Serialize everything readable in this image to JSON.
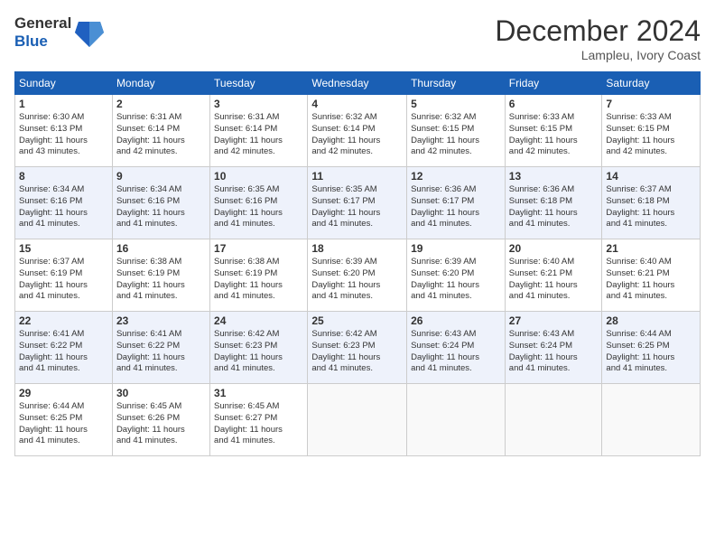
{
  "header": {
    "logo_line1": "General",
    "logo_line2": "Blue",
    "month_title": "December 2024",
    "location": "Lampleu, Ivory Coast"
  },
  "days_of_week": [
    "Sunday",
    "Monday",
    "Tuesday",
    "Wednesday",
    "Thursday",
    "Friday",
    "Saturday"
  ],
  "weeks": [
    [
      {
        "day": "1",
        "sunrise": "6:30 AM",
        "sunset": "6:13 PM",
        "daylight": "11 hours and 43 minutes."
      },
      {
        "day": "2",
        "sunrise": "6:31 AM",
        "sunset": "6:14 PM",
        "daylight": "11 hours and 42 minutes."
      },
      {
        "day": "3",
        "sunrise": "6:31 AM",
        "sunset": "6:14 PM",
        "daylight": "11 hours and 42 minutes."
      },
      {
        "day": "4",
        "sunrise": "6:32 AM",
        "sunset": "6:14 PM",
        "daylight": "11 hours and 42 minutes."
      },
      {
        "day": "5",
        "sunrise": "6:32 AM",
        "sunset": "6:15 PM",
        "daylight": "11 hours and 42 minutes."
      },
      {
        "day": "6",
        "sunrise": "6:33 AM",
        "sunset": "6:15 PM",
        "daylight": "11 hours and 42 minutes."
      },
      {
        "day": "7",
        "sunrise": "6:33 AM",
        "sunset": "6:15 PM",
        "daylight": "11 hours and 42 minutes."
      }
    ],
    [
      {
        "day": "8",
        "sunrise": "6:34 AM",
        "sunset": "6:16 PM",
        "daylight": "11 hours and 41 minutes."
      },
      {
        "day": "9",
        "sunrise": "6:34 AM",
        "sunset": "6:16 PM",
        "daylight": "11 hours and 41 minutes."
      },
      {
        "day": "10",
        "sunrise": "6:35 AM",
        "sunset": "6:16 PM",
        "daylight": "11 hours and 41 minutes."
      },
      {
        "day": "11",
        "sunrise": "6:35 AM",
        "sunset": "6:17 PM",
        "daylight": "11 hours and 41 minutes."
      },
      {
        "day": "12",
        "sunrise": "6:36 AM",
        "sunset": "6:17 PM",
        "daylight": "11 hours and 41 minutes."
      },
      {
        "day": "13",
        "sunrise": "6:36 AM",
        "sunset": "6:18 PM",
        "daylight": "11 hours and 41 minutes."
      },
      {
        "day": "14",
        "sunrise": "6:37 AM",
        "sunset": "6:18 PM",
        "daylight": "11 hours and 41 minutes."
      }
    ],
    [
      {
        "day": "15",
        "sunrise": "6:37 AM",
        "sunset": "6:19 PM",
        "daylight": "11 hours and 41 minutes."
      },
      {
        "day": "16",
        "sunrise": "6:38 AM",
        "sunset": "6:19 PM",
        "daylight": "11 hours and 41 minutes."
      },
      {
        "day": "17",
        "sunrise": "6:38 AM",
        "sunset": "6:19 PM",
        "daylight": "11 hours and 41 minutes."
      },
      {
        "day": "18",
        "sunrise": "6:39 AM",
        "sunset": "6:20 PM",
        "daylight": "11 hours and 41 minutes."
      },
      {
        "day": "19",
        "sunrise": "6:39 AM",
        "sunset": "6:20 PM",
        "daylight": "11 hours and 41 minutes."
      },
      {
        "day": "20",
        "sunrise": "6:40 AM",
        "sunset": "6:21 PM",
        "daylight": "11 hours and 41 minutes."
      },
      {
        "day": "21",
        "sunrise": "6:40 AM",
        "sunset": "6:21 PM",
        "daylight": "11 hours and 41 minutes."
      }
    ],
    [
      {
        "day": "22",
        "sunrise": "6:41 AM",
        "sunset": "6:22 PM",
        "daylight": "11 hours and 41 minutes."
      },
      {
        "day": "23",
        "sunrise": "6:41 AM",
        "sunset": "6:22 PM",
        "daylight": "11 hours and 41 minutes."
      },
      {
        "day": "24",
        "sunrise": "6:42 AM",
        "sunset": "6:23 PM",
        "daylight": "11 hours and 41 minutes."
      },
      {
        "day": "25",
        "sunrise": "6:42 AM",
        "sunset": "6:23 PM",
        "daylight": "11 hours and 41 minutes."
      },
      {
        "day": "26",
        "sunrise": "6:43 AM",
        "sunset": "6:24 PM",
        "daylight": "11 hours and 41 minutes."
      },
      {
        "day": "27",
        "sunrise": "6:43 AM",
        "sunset": "6:24 PM",
        "daylight": "11 hours and 41 minutes."
      },
      {
        "day": "28",
        "sunrise": "6:44 AM",
        "sunset": "6:25 PM",
        "daylight": "11 hours and 41 minutes."
      }
    ],
    [
      {
        "day": "29",
        "sunrise": "6:44 AM",
        "sunset": "6:25 PM",
        "daylight": "11 hours and 41 minutes."
      },
      {
        "day": "30",
        "sunrise": "6:45 AM",
        "sunset": "6:26 PM",
        "daylight": "11 hours and 41 minutes."
      },
      {
        "day": "31",
        "sunrise": "6:45 AM",
        "sunset": "6:27 PM",
        "daylight": "11 hours and 41 minutes."
      },
      null,
      null,
      null,
      null
    ]
  ]
}
